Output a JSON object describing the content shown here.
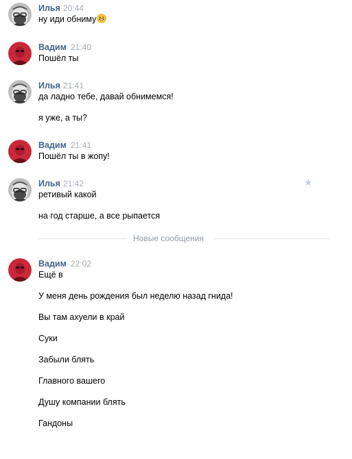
{
  "messages": [
    {
      "author": "Илья",
      "time": "20:44",
      "lines": [
        "ну иди обниму"
      ]
    },
    {
      "author": "Вадим",
      "time": "21:40",
      "lines": [
        "Пошёл ты"
      ]
    },
    {
      "author": "Илья",
      "time": "21:41",
      "lines": [
        "да ладно тебе, давай обнимемся!",
        "я уже, а ты?"
      ]
    },
    {
      "author": "Вадим",
      "time": "21:41",
      "lines": [
        "Пошёл ты в жопу!"
      ]
    },
    {
      "author": "Илья",
      "time": "21:42",
      "lines": [
        "ретивый какой",
        "на год старше, а все рыпается"
      ]
    },
    {
      "author": "Вадим",
      "time": "22:02",
      "lines": [
        "Ещё в",
        "У меня день рождения был неделю назад гнида!",
        "Вы там ахуели в край",
        "Суки",
        "Забыли блять",
        "Главного вашего",
        "Душу компании блять",
        "Гандоны"
      ]
    }
  ],
  "divider": {
    "label": "Новые сообщения"
  },
  "icons": {
    "emoji": "grinning-emoji",
    "star": "star-icon"
  },
  "colors": {
    "author": "#42648b",
    "time": "#a4abb3",
    "divider_text": "#939aa3",
    "star": "#c4cdd8",
    "avatar_vadim": "#c9283a"
  }
}
